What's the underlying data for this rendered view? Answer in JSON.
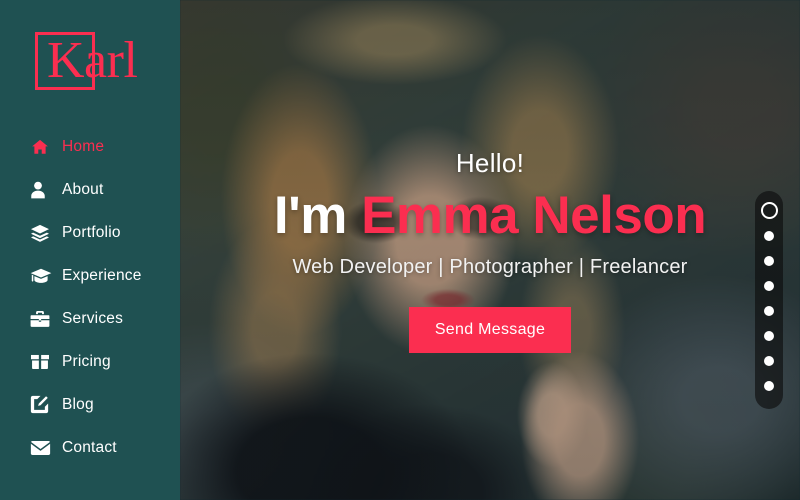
{
  "theme": {
    "sidebar_bg": "#1f5152",
    "accent": "#fb2e50",
    "nav_text": "#ffffff",
    "button_bg": "#fb2e50",
    "button_text": "#ffffff"
  },
  "sidebar": {
    "logo_text": "Karl",
    "nav": [
      {
        "label": "Home",
        "icon": "home-icon",
        "active": true
      },
      {
        "label": "About",
        "icon": "user-icon",
        "active": false
      },
      {
        "label": "Portfolio",
        "icon": "layers-icon",
        "active": false
      },
      {
        "label": "Experience",
        "icon": "graduation-cap-icon",
        "active": false
      },
      {
        "label": "Services",
        "icon": "briefcase-icon",
        "active": false
      },
      {
        "label": "Pricing",
        "icon": "box-icon",
        "active": false
      },
      {
        "label": "Blog",
        "icon": "pen-square-icon",
        "active": false
      },
      {
        "label": "Contact",
        "icon": "envelope-icon",
        "active": false
      }
    ]
  },
  "hero": {
    "greeting": "Hello!",
    "name_prefix": "I'm ",
    "name": "Emma Nelson",
    "roles": "Web Developer | Photographer | Freelancer",
    "cta_label": "Send Message"
  },
  "slider": {
    "total_dots": 8,
    "active_index": 0
  }
}
